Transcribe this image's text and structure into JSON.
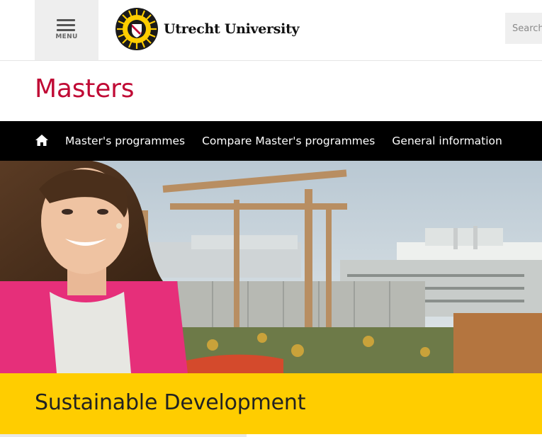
{
  "header": {
    "menu_label": "MENU",
    "logo_text": "Utrecht University",
    "search_placeholder": "Search"
  },
  "section": {
    "title": "Masters"
  },
  "nav": {
    "items": [
      {
        "label": "Master's programmes"
      },
      {
        "label": "Compare Master's programmes"
      },
      {
        "label": "General information"
      }
    ]
  },
  "hero": {
    "alt": "Student on rooftop garden"
  },
  "banner": {
    "title": "Sustainable Development"
  },
  "colors": {
    "brand_red": "#c00a35",
    "brand_yellow": "#ffcd00",
    "nav_bg": "#000000"
  },
  "icons": [
    "menu-icon",
    "university-seal-icon",
    "home-icon"
  ]
}
